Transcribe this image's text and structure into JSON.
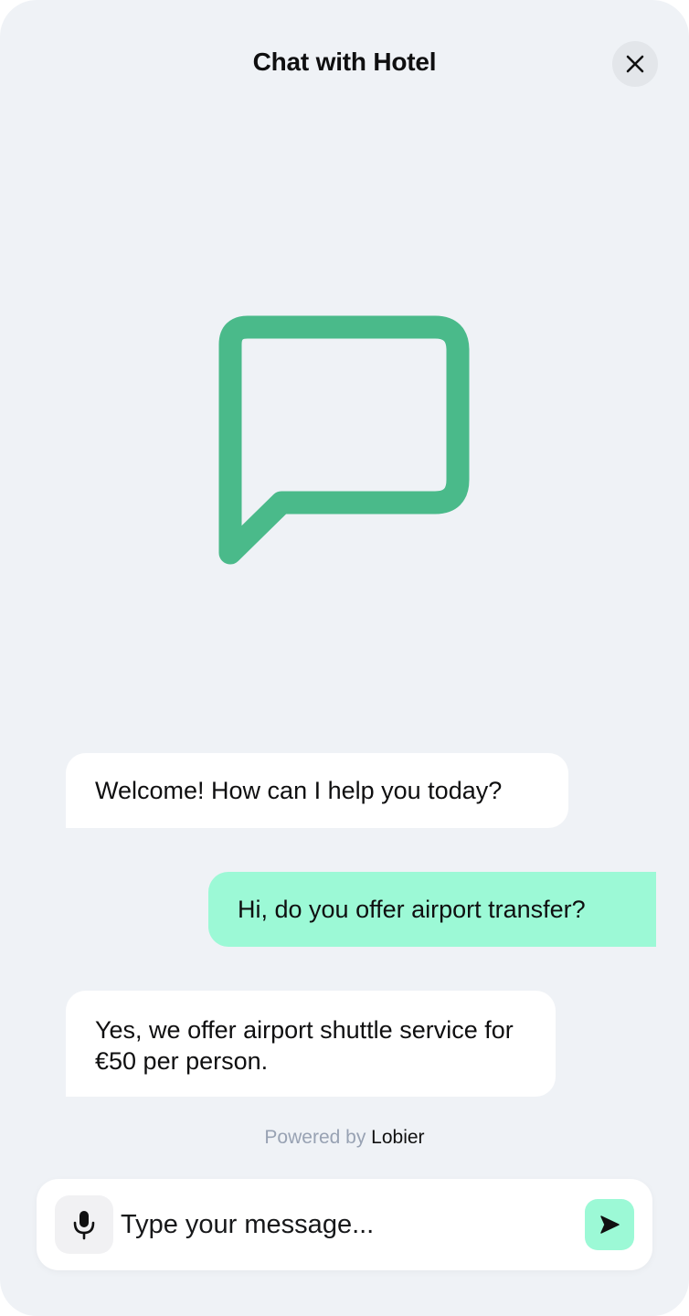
{
  "header": {
    "title": "Chat with Hotel",
    "close_icon": "close-icon"
  },
  "hero": {
    "icon": "chat-bubble-icon",
    "color": "#4aba8a"
  },
  "messages": [
    {
      "role": "bot",
      "text": "Welcome! How can I help you today?"
    },
    {
      "role": "user",
      "text": "Hi, do you offer airport transfer?"
    },
    {
      "role": "bot",
      "text": "Yes, we offer airport shuttle service for €50 per person."
    }
  ],
  "footer": {
    "powered_prefix": "Powered by",
    "powered_brand": "Lobier"
  },
  "composer": {
    "placeholder": "Type your message...",
    "mic_icon": "microphone-icon",
    "send_icon": "send-icon"
  },
  "colors": {
    "background": "#eff2f6",
    "user_bubble": "#9cf9d6",
    "bot_bubble": "#ffffff",
    "accent": "#4aba8a"
  }
}
